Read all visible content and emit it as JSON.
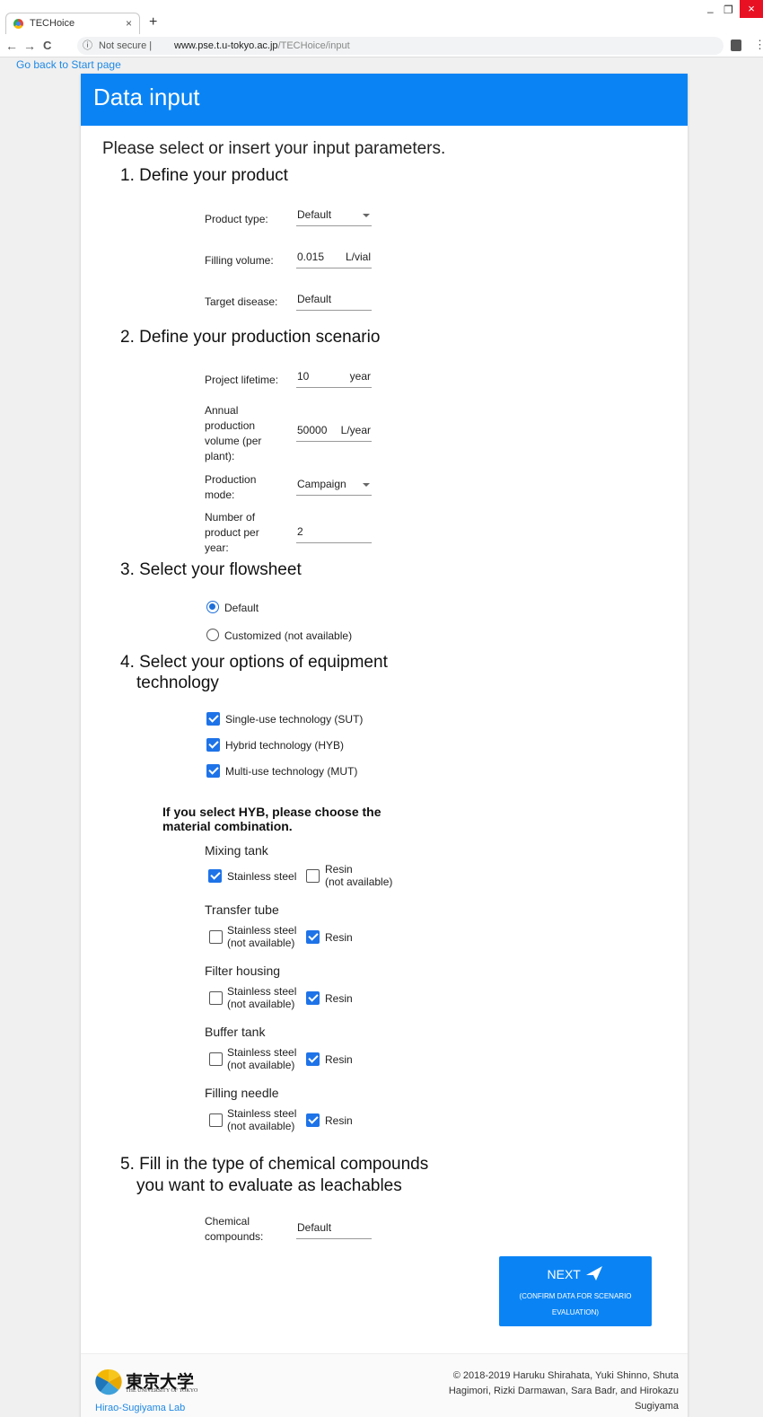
{
  "browser": {
    "tab_title": "TECHoice",
    "tab_close": "×",
    "new_tab": "+",
    "win_min": "–",
    "win_max": "❐",
    "win_close": "×",
    "nav_back": "←",
    "nav_forward": "→",
    "nav_reload": "C",
    "info_icon": "ⓘ",
    "security": "Not secure  |",
    "url_host": "www.pse.t.u-tokyo.ac.jp",
    "url_path": "/TECHoice/input",
    "menu": "⋮"
  },
  "back_link": "Go back to Start page",
  "header": {
    "title": "Data input"
  },
  "intro": "Please select or insert your input parameters.",
  "section1": {
    "title": "1. Define your product",
    "product_type": {
      "label": "Product type:",
      "value": "Default"
    },
    "filling_volume": {
      "label": "Filling volume:",
      "value": "0.015",
      "unit": "L/vial"
    },
    "target_disease": {
      "label": "Target disease:",
      "value": "Default"
    }
  },
  "section2": {
    "title": "2. Define your production scenario",
    "project_lifetime": {
      "label": "Project lifetime:",
      "value": "10",
      "unit": "year"
    },
    "annual_volume": {
      "label": "Annual production volume (per plant):",
      "value": "50000",
      "unit": "L/year"
    },
    "production_mode": {
      "label": "Production mode:",
      "value": "Campaign"
    },
    "products_per_year": {
      "label": "Number of product per year:",
      "value": "2"
    }
  },
  "section3": {
    "title": "3. Select your flowsheet",
    "opt_default": "Default",
    "opt_custom": "Customized (not available)"
  },
  "section4": {
    "title_line1": "4. Select your options of equipment",
    "title_line2": "technology",
    "sut": "Single-use technology (SUT)",
    "hyb": "Hybrid technology (HYB)",
    "mut": "Multi-use technology (MUT)",
    "hyb_note": "If you select HYB, please choose the material combination.",
    "stainless": "Stainless steel",
    "stainless_line1": "Stainless steel",
    "resin": "Resin",
    "not_available": "(not available)",
    "mixing_tank": "Mixing tank",
    "transfer_tube": "Transfer tube",
    "filter_housing": "Filter housing",
    "buffer_tank": "Buffer tank",
    "filling_needle": "Filling needle"
  },
  "section5": {
    "title_line1": "5. Fill in the type of chemical compounds",
    "title_line2": "you want to evaluate as leachables",
    "chemical": {
      "label": "Chemical compounds:",
      "value": "Default"
    }
  },
  "next_button": {
    "label": "NEXT",
    "sub1": "(CONFIRM DATA FOR SCENARIO",
    "sub2": "EVALUATION)"
  },
  "footer": {
    "logo_jp": "東京大学",
    "logo_en": "THE UNIVERSITY OF TOKYO",
    "lab": "Hirao-Sugiyama Lab",
    "copyright": "© 2018-2019 Haruku Shirahata, Yuki Shinno, Shuta Hagimori, Rizki Darmawan, Sara Badr, and Hirokazu Sugiyama"
  },
  "colors": {
    "accent": "#0a84f5",
    "link": "#1e88e5",
    "check": "#1e73e8"
  }
}
